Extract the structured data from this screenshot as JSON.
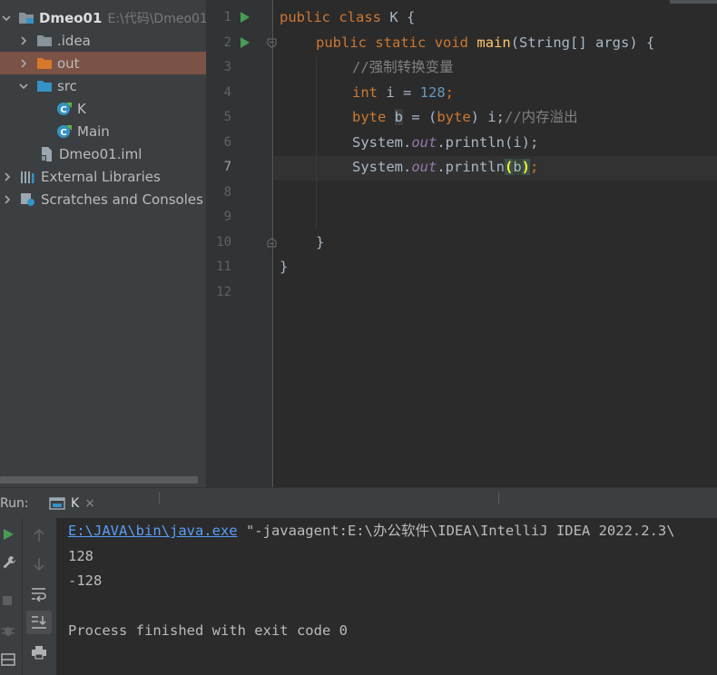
{
  "project_tree": {
    "items": [
      {
        "label": "Dmeo01",
        "path": "E:\\代码\\Dmeo01",
        "icon": "module-folder-icon"
      },
      {
        "label": ".idea",
        "icon": "folder-icon"
      },
      {
        "label": "out",
        "icon": "folder-orange-icon"
      },
      {
        "label": "src",
        "icon": "source-folder-icon"
      },
      {
        "label": "K",
        "icon": "java-class-icon"
      },
      {
        "label": "Main",
        "icon": "java-class-icon"
      },
      {
        "label": "Dmeo01.iml",
        "icon": "iml-file-icon"
      },
      {
        "label": "External Libraries",
        "icon": "libraries-icon"
      },
      {
        "label": "Scratches and Consoles",
        "icon": "scratches-icon"
      }
    ]
  },
  "editor": {
    "line_numbers": [
      "1",
      "2",
      "3",
      "4",
      "5",
      "6",
      "7",
      "8",
      "9",
      "10",
      "11",
      "12"
    ],
    "current_line": "7",
    "code": {
      "l1_kw1": "public",
      "l1_kw2": "class",
      "l1_rest": " K {",
      "l2_kw1": "public",
      "l2_kw2": "static",
      "l2_kw3": "void",
      "l2_fn": "main",
      "l2_rest": "(String[] args) {",
      "l3_comment": "//强制转换变量",
      "l4_kw": "int",
      "l4_mid": " i = ",
      "l4_num": "128",
      "l4_end": ";",
      "l5_kw": "byte",
      "l5_var": "b",
      "l5_mid": " = (",
      "l5_kw2": "byte",
      "l5_rest": ") i;",
      "l5_comment": "//内存溢出",
      "l6_pre": "System.",
      "l6_out": "out",
      "l6_rest": ".println(i);",
      "l7_pre": "System.",
      "l7_out": "out",
      "l7_mid": ".println",
      "l7_po": "(",
      "l7_var": "b",
      "l7_pc": ")",
      "l7_end": ";",
      "l10": "}",
      "l11": "}"
    }
  },
  "run_panel": {
    "label": "Run:",
    "tab_name": "K",
    "tab_close": "×",
    "console": {
      "cmd_link": "E:\\JAVA\\bin\\java.exe",
      "cmd_rest": " \"-javaagent:E:\\办公软件\\IDEA\\IntelliJ IDEA 2022.2.3\\",
      "out1": "128",
      "out2": "-128",
      "finish": "Process finished with exit code 0"
    }
  },
  "colors": {
    "selection": "#7b5246",
    "keyword": "#cc7832",
    "number": "#6897bb",
    "comment": "#808080",
    "method": "#ffc66d",
    "static_field": "#9876aa",
    "link": "#589df6",
    "run_green": "#499c54"
  }
}
